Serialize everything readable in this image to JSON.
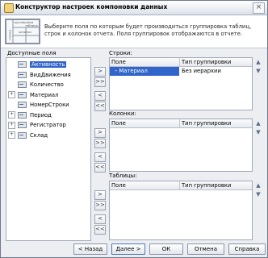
{
  "window": {
    "title": "Конструктор настроек компоновки данных",
    "close_glyph": "×"
  },
  "header": {
    "description": "Выберите поля по которым будет производиться группировка таблиц, строк и колонок отчета. Поля группировок отображаются в отчете.",
    "image_labels": {
      "grouping": "группировка",
      "table": "таблица",
      "rows": "строки",
      "columns": "колонки"
    }
  },
  "available_fields": {
    "title": "Доступные поля",
    "items": [
      {
        "label": "Активность",
        "expandable": false,
        "selected": true
      },
      {
        "label": "ВидДвижения",
        "expandable": false,
        "selected": false
      },
      {
        "label": "Количество",
        "expandable": false,
        "selected": false
      },
      {
        "label": "Материал",
        "expandable": true,
        "selected": false
      },
      {
        "label": "НомерСтроки",
        "expandable": false,
        "selected": false
      },
      {
        "label": "Период",
        "expandable": true,
        "selected": false
      },
      {
        "label": "Регистратор",
        "expandable": true,
        "selected": false
      },
      {
        "label": "Склад",
        "expandable": true,
        "selected": false
      }
    ],
    "expand_glyph": "+"
  },
  "move_buttons": {
    "add": ">",
    "add_all": ">>",
    "remove": "<",
    "remove_all": "<<"
  },
  "updown": {
    "up": "▲",
    "down": "▼"
  },
  "groups": {
    "rows": {
      "title": "Строки:",
      "col_field": "Поле",
      "col_type": "Тип группировки",
      "items": [
        {
          "field": "Материал",
          "type": "Без иерархии",
          "selected": true
        }
      ]
    },
    "columns": {
      "title": "Колонки:",
      "col_field": "Поле",
      "col_type": "Тип группировки",
      "items": []
    },
    "tables": {
      "title": "Таблицы:",
      "col_field": "Поле",
      "col_type": "Тип группировки",
      "items": []
    }
  },
  "footer": {
    "back": "< Назад",
    "next": "Далее >",
    "ok": "ОК",
    "cancel": "Отмена",
    "help": "Справка"
  }
}
